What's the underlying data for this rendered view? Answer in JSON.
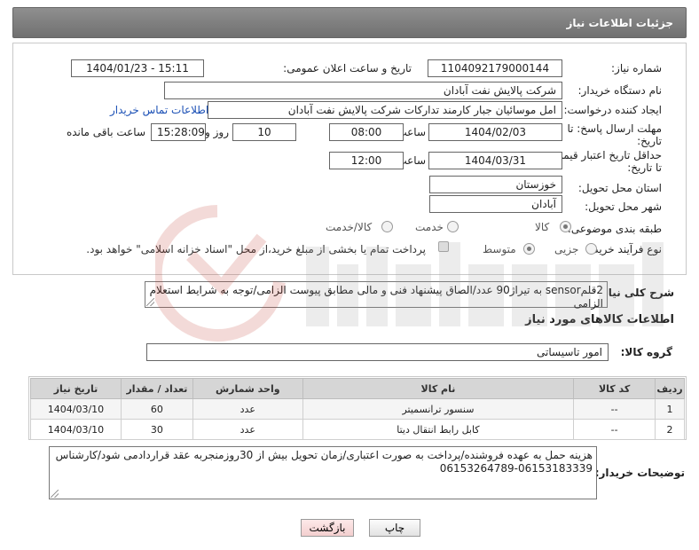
{
  "header": {
    "title": "جزئیات اطلاعات نیاز"
  },
  "form": {
    "need_number_label": "شماره نیاز:",
    "need_number": "1104092179000144",
    "announce_label": "تاریخ و ساعت اعلان عمومی:",
    "announce_value": "1404/01/23 - 15:11",
    "buyer_label": "نام دستگاه خریدار:",
    "buyer_value": "شرکت پالایش نفت آبادان",
    "creator_label": "ایجاد کننده درخواست:",
    "creator_value": "امل موسائیان جبار کارمند تدارکات شرکت پالایش نفت آبادان",
    "contact_link": "اطلاعات تماس خریدار",
    "deadline_label_1": "مهلت ارسال پاسخ: تا",
    "deadline_label_2": "تاریخ:",
    "deadline_date": "1404/02/03",
    "time_label": "ساعت",
    "deadline_time": "08:00",
    "days_value": "10",
    "days_label": "روز و",
    "remaining_time": "15:28:09",
    "remaining_label": "ساعت باقی مانده",
    "min_validity_label_1": "حداقل تاریخ اعتبار قیمت:",
    "min_validity_label_2": "تا تاریخ:",
    "validity_date": "1404/03/31",
    "validity_time": "12:00",
    "province_label": "استان محل تحویل:",
    "province_value": "خوزستان",
    "city_label": "شهر محل تحویل:",
    "city_value": "آبادان",
    "category_label": "طبقه بندی موضوعی:",
    "category_options": [
      "کالا",
      "خدمت",
      "کالا/خدمت"
    ],
    "process_label": "نوع فرآیند خرید :",
    "process_options": [
      "جزیی",
      "متوسط"
    ],
    "payment_text": "پرداخت تمام یا بخشی از مبلغ خرید،از محل \"اسناد خزانه اسلامی\" خواهد بود."
  },
  "description": {
    "label": "شرح کلی نیاز:",
    "value": "2قلمsensor به تیراژ90 عدد/الصاق پیشنهاد فنی و مالی مطابق پیوست الزامی/توجه به شرایط استعلام الزامی"
  },
  "goods": {
    "section_title": "اطلاعات کالاهای مورد نیاز",
    "group_label": "گروه کالا:",
    "group_value": "امور تاسیساتی",
    "columns": [
      "ردیف",
      "کد کالا",
      "نام کالا",
      "واحد شمارش",
      "تعداد / مقدار",
      "تاریخ نیاز"
    ],
    "rows": [
      {
        "row": "1",
        "code": "--",
        "name": "سنسور ترانسمیتر",
        "unit": "عدد",
        "qty": "60",
        "date": "1404/03/10"
      },
      {
        "row": "2",
        "code": "--",
        "name": "کابل رابط انتقال دیتا",
        "unit": "عدد",
        "qty": "30",
        "date": "1404/03/10"
      }
    ]
  },
  "notes": {
    "label": "توضیحات خریدار:",
    "line1": "هزینه حمل به عهده فروشنده/پرداخت به صورت اعتباری/زمان تحویل بیش از 30روزمنجربه عقد قراردادمی شود/کارشناس",
    "line2": "06153264789-06153183339"
  },
  "buttons": {
    "print": "چاپ",
    "back": "بازگشت"
  },
  "colors": {
    "header_bg": "#808080",
    "link": "#1a4fb5",
    "back_button": "#f3cfcf"
  }
}
